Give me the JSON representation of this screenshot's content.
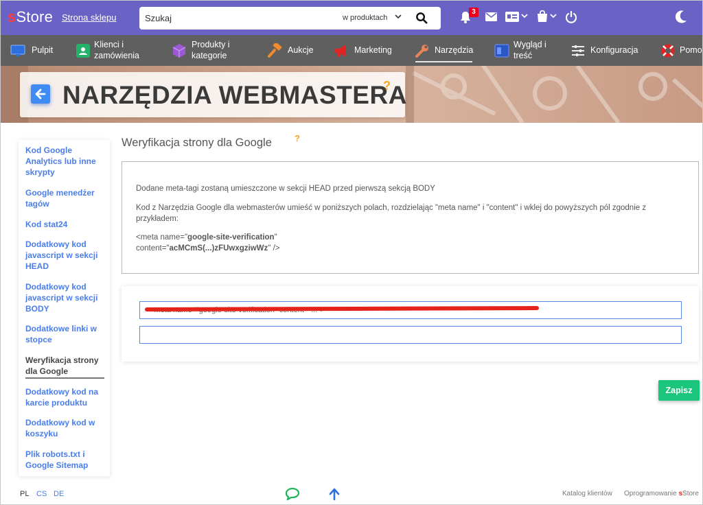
{
  "topbar": {
    "logo_s": "s",
    "logo_rest": "Store",
    "store_link": "Strona sklepu",
    "search_placeholder": "Szukaj",
    "search_scope": "w produktach",
    "notifications_count": "3"
  },
  "nav": {
    "items": [
      {
        "label_line1": "Pulpit",
        "label_line2": "",
        "icon": "monitor-icon"
      },
      {
        "label_line1": "Klienci i",
        "label_line2": "zamówienia",
        "icon": "contact-card-icon"
      },
      {
        "label_line1": "Produkty i",
        "label_line2": "kategorie",
        "icon": "cube-icon"
      },
      {
        "label_line1": "Aukcje",
        "label_line2": "",
        "icon": "gavel-icon"
      },
      {
        "label_line1": "Marketing",
        "label_line2": "",
        "icon": "megaphone-icon"
      },
      {
        "label_line1": "Narzędzia",
        "label_line2": "",
        "icon": "wrench-icon"
      },
      {
        "label_line1": "Wygląd i",
        "label_line2": "treść",
        "icon": "layout-icon"
      },
      {
        "label_line1": "Konfiguracja",
        "label_line2": "",
        "icon": "sliders-icon"
      },
      {
        "label_line1": "Pomoc",
        "label_line2": "",
        "icon": "lifebuoy-icon"
      }
    ]
  },
  "page": {
    "title": "NARZĘDZIA WEBMASTERA",
    "help": "?"
  },
  "sidebar": {
    "items": [
      {
        "label": "Kod Google Analytics lub inne skrypty"
      },
      {
        "label": "Google menedżer tagów"
      },
      {
        "label": "Kod stat24"
      },
      {
        "label": "Dodatkowy kod javascript w sekcji HEAD"
      },
      {
        "label": "Dodatkowy kod javascript w sekcji BODY"
      },
      {
        "label": "Dodatkowe linki w stopce"
      },
      {
        "label": "Weryfikacja strony dla Google"
      },
      {
        "label": "Dodatkowy kod na karcie produktu"
      },
      {
        "label": "Dodatkowy kod w koszyku"
      },
      {
        "label": "Plik robots.txt i Google Sitemap"
      }
    ]
  },
  "main": {
    "section_title": "Weryfikacja strony dla Google",
    "help": "?",
    "info_line1": "Dodane meta-tagi zostaną umieszczone w sekcji HEAD przed pierwszą sekcją BODY",
    "info_line2a": "Kod z Narzędzia Google dla webmasterów umieść w poniższych polach, rozdzielając \"meta name\" i \"content\" i wklej do powyższych pól zgodnie z",
    "info_line2b": "przykładem:",
    "example_prefix1": "<meta name=\"",
    "example_bold1": "google-site-verification",
    "example_suffix1": "\"",
    "example_prefix2": "content=\"",
    "example_bold2": "acMCmS(...)zFUwxgziwWz",
    "example_suffix2": "\" />",
    "field1_value": "<meta name=\"google-site-verification\" content=\"...\">",
    "field2_value": "",
    "save_label": "Zapisz"
  },
  "footer": {
    "languages": [
      "PL",
      "CS",
      "DE"
    ],
    "catalog_link": "Katalog klientów",
    "software_prefix": "Oprogramowanie ",
    "software_s": "s",
    "software_rest": "Store"
  }
}
